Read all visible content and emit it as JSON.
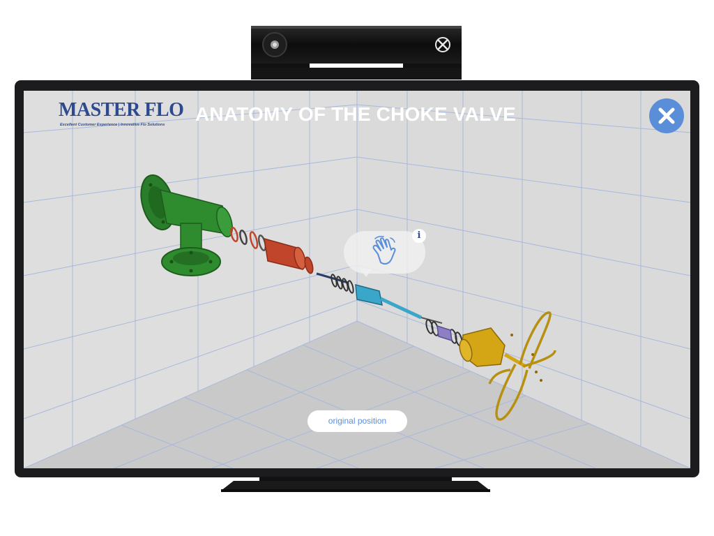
{
  "header": {
    "logo_name": "MASTER FLO",
    "logo_tagline": "Excellent Customer Experience | Innovative Flo Solutions",
    "title": "ANATOMY OF THE CHOKE VALVE"
  },
  "controls": {
    "close_icon": "close-icon",
    "info_label": "i",
    "gesture_icon": "hand-grab-icon",
    "original_position_label": "original position"
  },
  "colors": {
    "accent": "#5b8ed9",
    "brand": "#2d4a8f",
    "body_green": "#2e8b2e",
    "seat_red": "#c0452a",
    "stem_cyan": "#3aa6c9",
    "actuator_gold": "#d4a514"
  }
}
